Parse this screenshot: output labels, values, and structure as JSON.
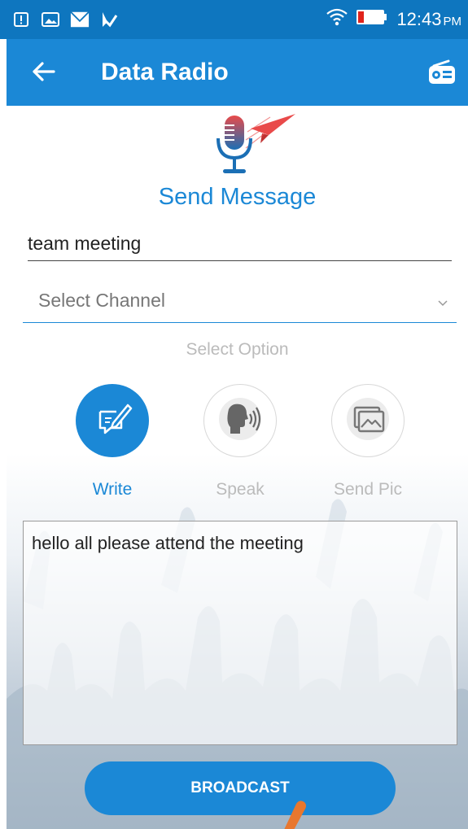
{
  "status_bar": {
    "icons": [
      "alert-icon",
      "image-icon",
      "mail-icon",
      "app-check-icon"
    ],
    "wifi_icon": "wifi-icon",
    "battery_icon": "battery-icon",
    "time": "12:43",
    "ampm": "PM"
  },
  "app_bar": {
    "back_icon": "arrow-left-icon",
    "title": "Data Radio",
    "radio_icon": "radio-icon",
    "color": "#1b88d6"
  },
  "form": {
    "header_title": "Send Message",
    "subject_value": "team meeting",
    "channel_placeholder": "Select Channel",
    "option_label": "Select Option",
    "options": [
      {
        "label": "Write",
        "icon": "write-icon",
        "active": true
      },
      {
        "label": "Speak",
        "icon": "speak-icon",
        "active": false
      },
      {
        "label": "Send Pic",
        "icon": "picture-icon",
        "active": false
      }
    ],
    "message": "hello all please attend the meeting",
    "broadcast_label": "BROADCAST"
  },
  "colors": {
    "accent": "#1b88d6",
    "status_bar": "#0e76bf",
    "inactive_text": "#bbbbbb",
    "pointer": "#e8772e"
  }
}
